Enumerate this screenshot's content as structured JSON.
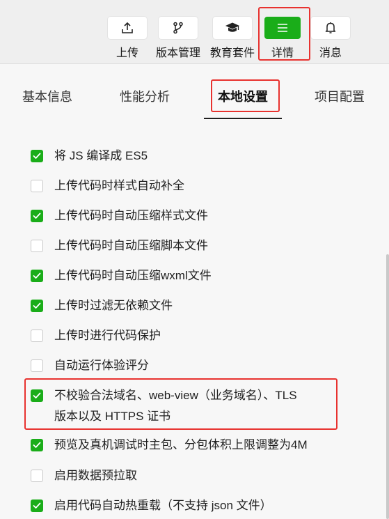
{
  "toolbar": {
    "upload": {
      "label": "上传",
      "icon": "upload-icon"
    },
    "version": {
      "label": "版本管理",
      "icon": "branch-icon"
    },
    "edu": {
      "label": "教育套件",
      "icon": "graduation-cap-icon"
    },
    "details": {
      "label": "详情",
      "icon": "menu-icon"
    },
    "messages": {
      "label": "消息",
      "icon": "bell-icon"
    }
  },
  "tabs": {
    "basic": "基本信息",
    "perf": "性能分析",
    "local": "本地设置",
    "project": "项目配置",
    "active": "local"
  },
  "options": [
    {
      "label": "将 JS 编译成 ES5",
      "checked": true
    },
    {
      "label": "上传代码时样式自动补全",
      "checked": false
    },
    {
      "label": "上传代码时自动压缩样式文件",
      "checked": true
    },
    {
      "label": "上传代码时自动压缩脚本文件",
      "checked": false
    },
    {
      "label": "上传代码时自动压缩wxml文件",
      "checked": true
    },
    {
      "label": "上传时过滤无依赖文件",
      "checked": true
    },
    {
      "label": "上传时进行代码保护",
      "checked": false
    },
    {
      "label": "自动运行体验评分",
      "checked": false
    },
    {
      "label_line1": "不校验合法域名、web-view（业务域名）、TLS",
      "label_line2": "版本以及 HTTPS 证书",
      "checked": true
    },
    {
      "label": "预览及真机调试时主包、分包体积上限调整为4M",
      "checked": true
    },
    {
      "label": "启用数据预拉取",
      "checked": false
    },
    {
      "label": "启用代码自动热重载（不支持 json 文件）",
      "checked": true
    }
  ],
  "colors": {
    "accent": "#1aad19",
    "highlight": "#e8322f"
  }
}
